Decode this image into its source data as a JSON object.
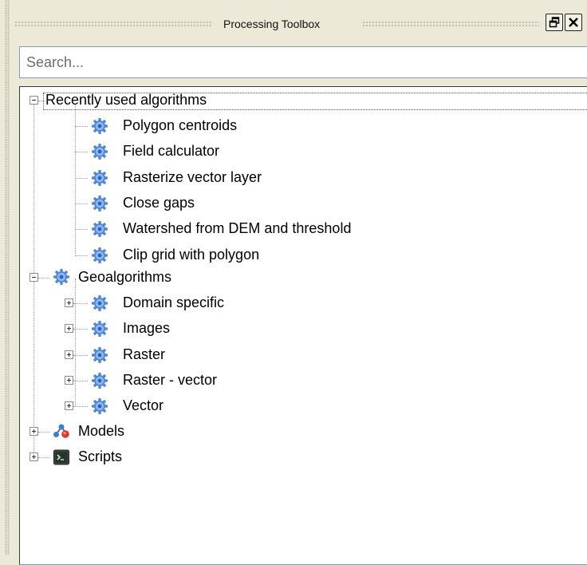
{
  "panel": {
    "title": "Processing Toolbox"
  },
  "search": {
    "placeholder": "Search..."
  },
  "tree": {
    "recent": {
      "label": "Recently used algorithms",
      "items": [
        "Polygon centroids",
        "Field calculator",
        "Rasterize vector layer",
        "Close gaps",
        "Watershed from DEM and threshold",
        "Clip grid with polygon"
      ]
    },
    "geoalgorithms": {
      "label": "Geoalgorithms",
      "items": [
        "Domain specific",
        "Images",
        "Raster",
        "Raster - vector",
        "Vector"
      ]
    },
    "models": {
      "label": "Models"
    },
    "scripts": {
      "label": "Scripts"
    }
  },
  "icons": {
    "float": "restore-window-icon",
    "close": "close-icon",
    "algorithm": "gear-icon",
    "models": "models-icon",
    "scripts": "terminal-icon"
  }
}
